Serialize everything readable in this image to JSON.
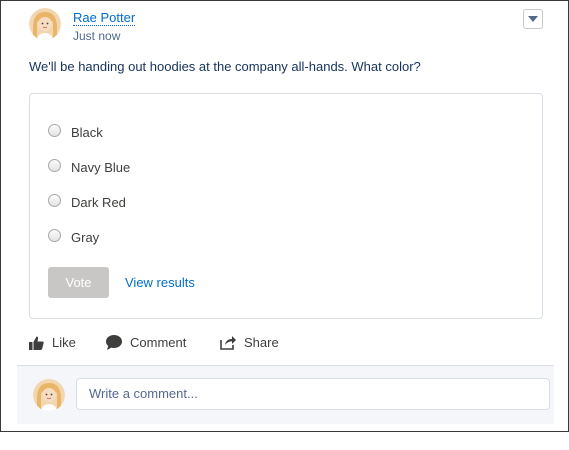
{
  "post": {
    "author": "Rae Potter",
    "timestamp": "Just now",
    "question": "We'll be handing out hoodies at the company all-hands. What color?"
  },
  "poll": {
    "options": [
      "Black",
      "Navy Blue",
      "Dark Red",
      "Gray"
    ],
    "vote_label": "Vote",
    "view_results_label": "View results"
  },
  "actions": {
    "like": "Like",
    "comment": "Comment",
    "share": "Share"
  },
  "comment_box": {
    "placeholder": "Write a comment..."
  },
  "icons": {
    "menu": "chevron-down-icon",
    "like": "thumbs-up-icon",
    "comment": "speech-bubble-icon",
    "share": "share-icon"
  },
  "colors": {
    "link": "#006dcc",
    "vote_disabled": "#c9c7c5",
    "comment_bar_bg": "#f4f6f9"
  }
}
